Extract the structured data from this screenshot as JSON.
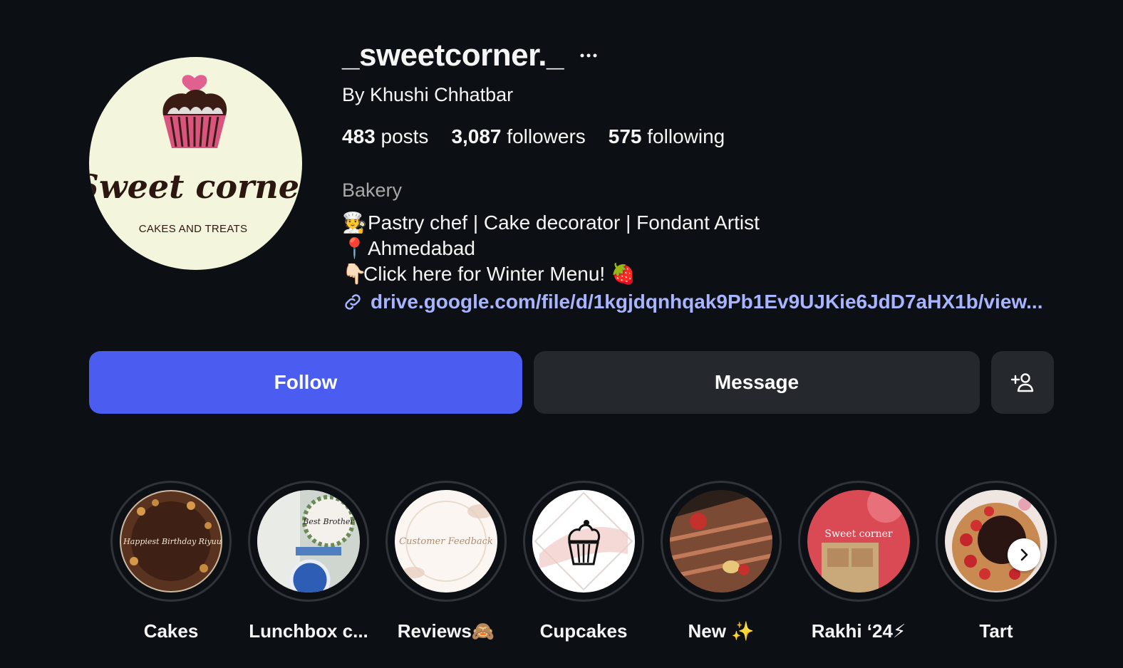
{
  "profile": {
    "username": "_sweetcorner._",
    "full_name": "By Khushi Chhatbar",
    "avatar_text": "Sweet corner",
    "avatar_subtext": "CAKES AND TREATS",
    "stats": {
      "posts_count": "483",
      "posts_label": "posts",
      "followers_count": "3,087",
      "followers_label": "followers",
      "following_count": "575",
      "following_label": "following"
    },
    "category": "Bakery",
    "bio": {
      "line1_emoji": "🧑‍🍳",
      "line1_text": "Pastry chef | Cake decorator | Fondant Artist",
      "line2_emoji": "📍",
      "line2_text": "Ahmedabad",
      "line3_emoji": "👇🏻",
      "line3_text": "Click here for Winter Menu! 🍓"
    },
    "link": "drive.google.com/file/d/1kgjdqnhqak9Pb1Ev9UJKie6JdD7aHX1b/view..."
  },
  "actions": {
    "follow_label": "Follow",
    "message_label": "Message",
    "suggest_icon": "add-person-icon"
  },
  "highlights": [
    {
      "label": "Cakes",
      "cover_text": "Happiest Birthday Riyuu"
    },
    {
      "label": "Lunchbox c...",
      "cover_text": "Best Brother"
    },
    {
      "label": "Reviews🙈",
      "cover_text": "Customer Feedback"
    },
    {
      "label": "Cupcakes",
      "cover_text": ""
    },
    {
      "label": "New ✨",
      "cover_text": ""
    },
    {
      "label": "Rakhi ‘24⚡",
      "cover_text": "Sweet corner"
    },
    {
      "label": "Tart",
      "cover_text": ""
    }
  ],
  "colors": {
    "background": "#0c1014",
    "follow_button": "#4a5df0",
    "secondary_button": "#25292e",
    "link": "#a8b4ff",
    "muted_text": "#a8a8a8"
  }
}
